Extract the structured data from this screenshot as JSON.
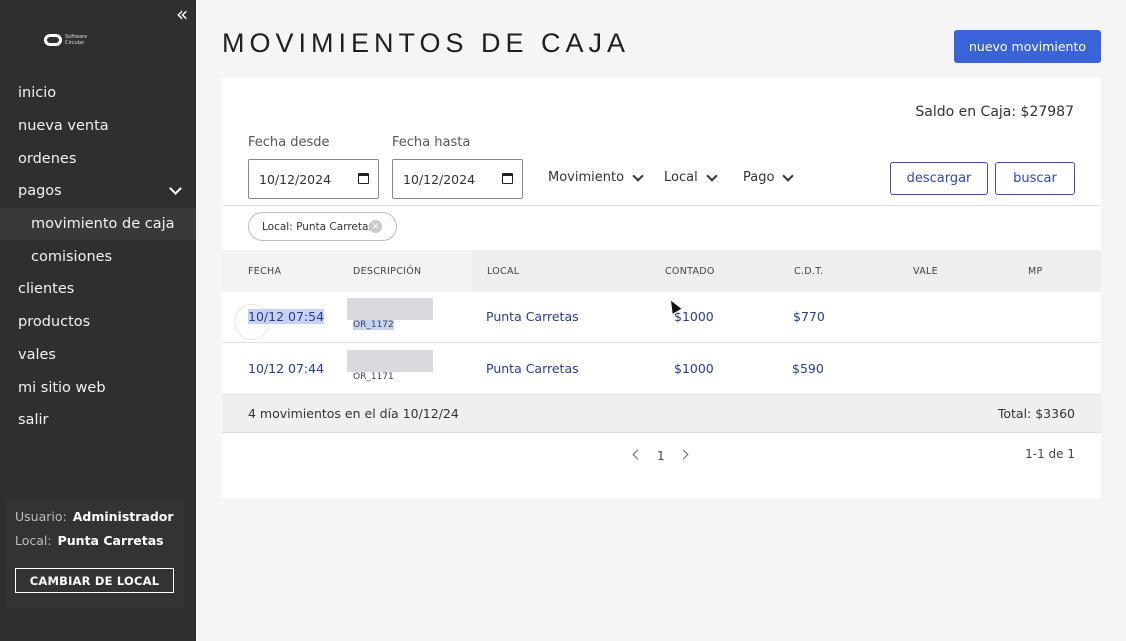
{
  "sidebar": {
    "logo_text": "Software Circular",
    "items": [
      {
        "label": "inicio"
      },
      {
        "label": "nueva venta"
      },
      {
        "label": "ordenes"
      },
      {
        "label": "pagos"
      },
      {
        "label": "movimiento de caja"
      },
      {
        "label": "comisiones"
      },
      {
        "label": "clientes"
      },
      {
        "label": "productos"
      },
      {
        "label": "vales"
      },
      {
        "label": "mi sitio web"
      },
      {
        "label": "salir"
      }
    ],
    "user_label": "Usuario:",
    "user_value": "Administrador",
    "local_label": "Local:",
    "local_value": "Punta Carretas",
    "change_button": "CAMBIAR DE LOCAL"
  },
  "header": {
    "title": "MOVIMIENTOS DE CAJA",
    "new_button": "nuevo movimiento"
  },
  "filters": {
    "saldo": "Saldo en Caja: $27987",
    "from_label": "Fecha desde",
    "from_value": "10/12/2024",
    "to_label": "Fecha hasta",
    "to_value": "10/12/2024",
    "movimiento": "Movimiento",
    "local": "Local",
    "pago": "Pago",
    "download_button": "descargar",
    "search_button": "buscar",
    "chip": "Local: Punta Carretas"
  },
  "table": {
    "headers": [
      "FECHA",
      "DESCRIPCIÓN",
      "LOCAL",
      "CONTADO",
      "C.D.T.",
      "VALE",
      "MP"
    ],
    "rows": [
      {
        "fecha": "10/12 07:54",
        "desc": "OR_1172",
        "local": "Punta Carretas",
        "contado": "$1000",
        "cdt": "$770",
        "vale": "",
        "mp": ""
      },
      {
        "fecha": "10/12 07:44",
        "desc": "OR_1171",
        "local": "Punta Carretas",
        "contado": "$1000",
        "cdt": "$590",
        "vale": "",
        "mp": ""
      }
    ],
    "summary_left": "4 movimientos en el día 10/12/24",
    "summary_right": "Total: $3360"
  },
  "pagination": {
    "page": "1",
    "range": "1-1 de 1"
  },
  "colors": {
    "sidebar_bg": "#2f2f2f",
    "accent": "#3b63d9",
    "link": "#2a3b8f"
  }
}
